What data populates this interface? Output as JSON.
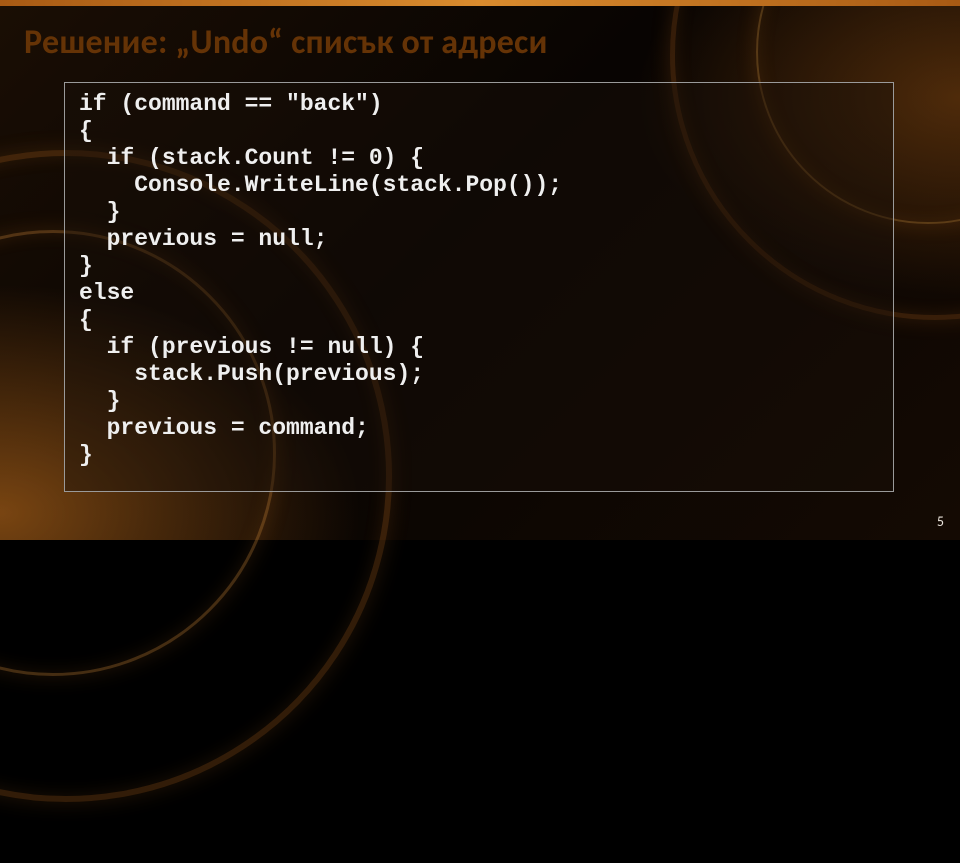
{
  "slide": {
    "title": "Решение: „Undo“ списък от адреси",
    "page_number": "5"
  },
  "code": {
    "l01": "if (command == \"back\")",
    "l02": "{",
    "l03": "  if (stack.Count != 0) {",
    "l04": "    Console.WriteLine(stack.Pop());",
    "l05": "  }",
    "l06": "  previous = null;",
    "l07": "}",
    "l08": "else",
    "l09": "{",
    "l10": "  if (previous != null) {",
    "l11": "    stack.Push(previous);",
    "l12": "  }",
    "l13": "  previous = command;",
    "l14": "}"
  }
}
